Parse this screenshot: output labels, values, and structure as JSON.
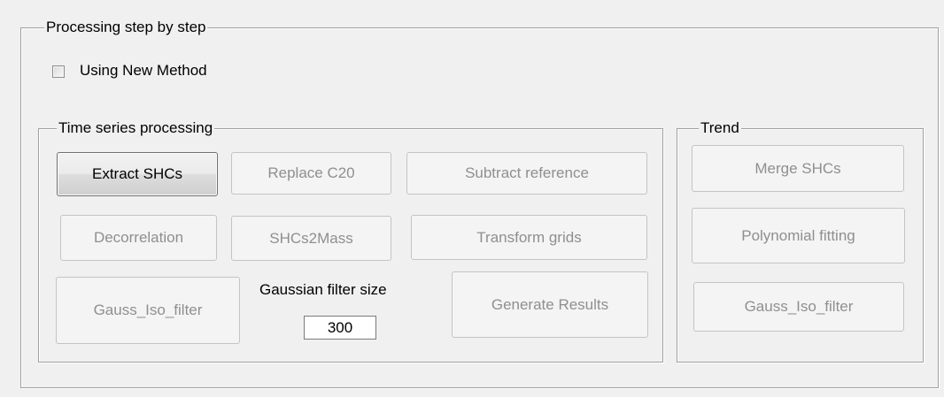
{
  "panel": {
    "title": "Processing step by step",
    "new_method": {
      "label": "Using New Method",
      "checked": false
    }
  },
  "time_series": {
    "title": "Time series processing",
    "extract_shcs": "Extract SHCs",
    "replace_c20": "Replace C20",
    "subtract_reference": "Subtract reference",
    "decorrelation": "Decorrelation",
    "shcs2mass": "SHCs2Mass",
    "transform_grids": "Transform grids",
    "gauss_iso_filter": "Gauss_Iso_filter",
    "gaussian_filter_size_label": "Gaussian filter size",
    "gaussian_filter_size_value": "300",
    "generate_results": "Generate Results"
  },
  "trend": {
    "title": "Trend",
    "merge_shcs": "Merge SHCs",
    "polynomial_fitting": "Polynomial fitting",
    "gauss_iso_filter": "Gauss_Iso_filter"
  }
}
